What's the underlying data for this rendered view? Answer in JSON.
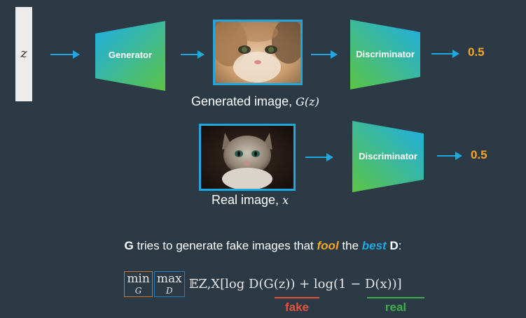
{
  "z_label": "z",
  "generator_label": "Generator",
  "discriminator_label": "Discriminator",
  "fake_output": "0.5",
  "real_output": "0.5",
  "generated_caption": "Generated image,",
  "generated_math": "G(z)",
  "real_caption": "Real image,",
  "real_math": "x",
  "statement": {
    "g": "G",
    "text1": " tries to generate fake images that ",
    "fool": "fool",
    "text2": " the ",
    "best": "best",
    "text3": " ",
    "d": "D",
    "colon": ":"
  },
  "formula": {
    "min": "min",
    "min_sub": "G",
    "max": "max",
    "max_sub": "D",
    "expression": "𝔼Z,X[log D(G(z)) + log(1 − D(x))]"
  },
  "fake_label": "fake",
  "real_label": "real",
  "colors": {
    "background": "#2c3a46",
    "arrow": "#1fa8e0",
    "output": "#f5a623",
    "fake": "#e2533a",
    "real": "#3fae4a",
    "gradient_start": "#1eaee8",
    "gradient_end": "#5cc445"
  }
}
